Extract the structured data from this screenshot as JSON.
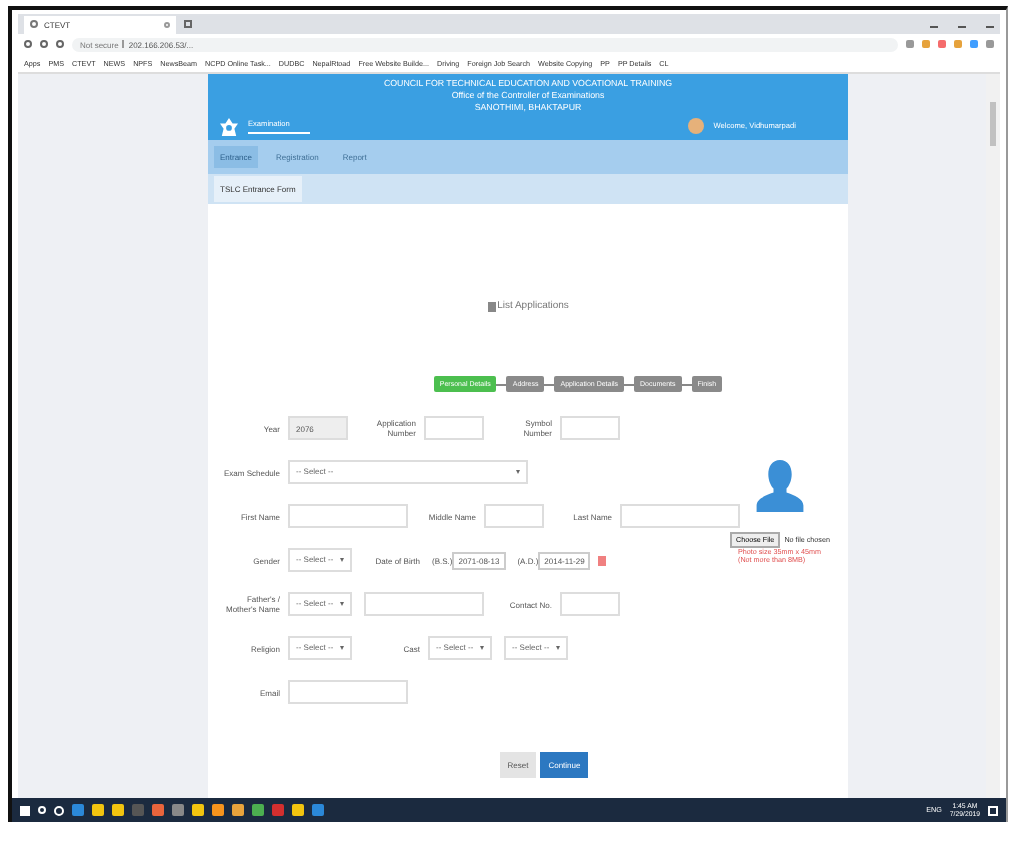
{
  "browser": {
    "tab_title": "CTEVT",
    "address_security": "Not secure",
    "address_url": "202.166.206.53/...",
    "bookmarks": [
      "Apps",
      "PMS",
      "CTEVT",
      "NEWS",
      "NPFS",
      "NewsBeam",
      "NCPD Online Task...",
      "DUDBC",
      "NepalRtoad",
      "Free Website Builde...",
      "Driving",
      "Foreign Job Search",
      "Website Copying",
      "PP",
      "PP Details",
      "CL"
    ]
  },
  "header": {
    "lines": [
      "COUNCIL FOR TECHNICAL EDUCATION AND VOCATIONAL TRAINING",
      "Office of the Controller of Examinations",
      "SANOTHIMI, BHAKTAPUR"
    ],
    "brand": "Examination",
    "welcome": "Welcome, Vidhumarpadi"
  },
  "menu": [
    {
      "label": "Entrance",
      "selected": true
    },
    {
      "label": "Registration",
      "selected": false
    },
    {
      "label": "Report",
      "selected": false
    }
  ],
  "subtab": "TSLC Entrance Form",
  "title": "List Applications",
  "steps": [
    {
      "label": "Personal Details",
      "selected": true
    },
    {
      "label": "Address",
      "selected": false
    },
    {
      "label": "Application Details",
      "selected": false
    },
    {
      "label": "Documents",
      "selected": false
    },
    {
      "label": "Finish",
      "selected": false
    }
  ],
  "rows": [
    [
      {
        "kind": "input",
        "label": "Year",
        "value": "2076",
        "disabled": true
      },
      {
        "kind": "input",
        "label": "Application Number",
        "disabled": false
      },
      {
        "kind": "input",
        "label": "Symbol Number",
        "disabled": false
      }
    ],
    [
      {
        "kind": "wide_select",
        "label": "Exam Schedule",
        "value": "-- Select --"
      }
    ],
    [
      {
        "kind": "wide_input",
        "label": "First Name",
        "disabled": false
      },
      {
        "kind": "input",
        "label": "Middle Name",
        "disabled": false
      },
      {
        "kind": "wide_input",
        "label": "Last Name",
        "disabled": false
      }
    ],
    [
      {
        "kind": "select",
        "label": "Gender",
        "value": "-- Select --"
      },
      {
        "kind": "date",
        "label": "Date of Birth",
        "bs_label": "(B.S.)",
        "bs": "2071-08-13",
        "ad_label": "(A.D.)",
        "ad": "2014-11-29"
      }
    ],
    [
      {
        "kind": "select",
        "label": "Father's / Mother's Name",
        "value": "-- Select --"
      },
      {
        "kind": "wide_input",
        "disabled": false
      },
      {
        "kind": "input",
        "label": "Contact No.",
        "disabled": false
      }
    ],
    [
      {
        "kind": "select",
        "label": "Religion",
        "value": "-- Select --"
      },
      {
        "kind": "select",
        "label": "Cast",
        "value": "-- Select --"
      },
      {
        "kind": "select",
        "value": "-- Select --"
      }
    ],
    [
      {
        "kind": "wide_input",
        "label": "Email",
        "disabled": false
      }
    ]
  ],
  "photo": {
    "button": "Choose File",
    "status": "No file chosen",
    "notes": [
      "Photo size 35mm x 45mm",
      "(Not more than 8MB)"
    ]
  },
  "buttons": [
    {
      "label": "Reset",
      "kind": "secondary"
    },
    {
      "label": "Continue",
      "kind": "primary"
    }
  ],
  "taskbar": {
    "language": "ENG",
    "time": "1:45 AM",
    "date": "7/29/2019"
  }
}
